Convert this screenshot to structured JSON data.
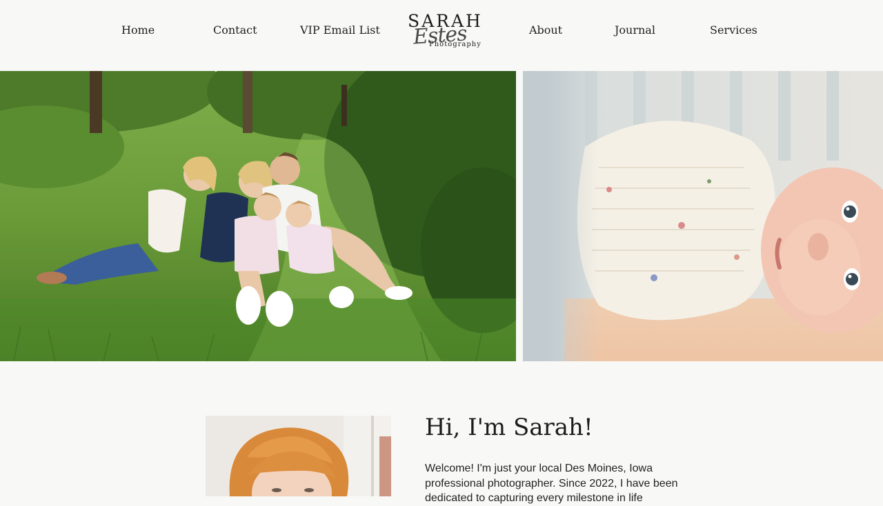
{
  "nav": {
    "left": [
      {
        "label": "Home"
      },
      {
        "label": "Contact"
      },
      {
        "label": "VIP Email List"
      }
    ],
    "right": [
      {
        "label": "About"
      },
      {
        "label": "Journal"
      },
      {
        "label": "Services"
      }
    ]
  },
  "logo": {
    "top": "SARAH",
    "script": "Estes",
    "sub": "Photography"
  },
  "about": {
    "heading": "Hi, I'm Sarah!",
    "text": "Welcome! I'm just your local Des Moines, Iowa professional photographer. Since 2022, I have been dedicated to capturing every milestone in life"
  }
}
